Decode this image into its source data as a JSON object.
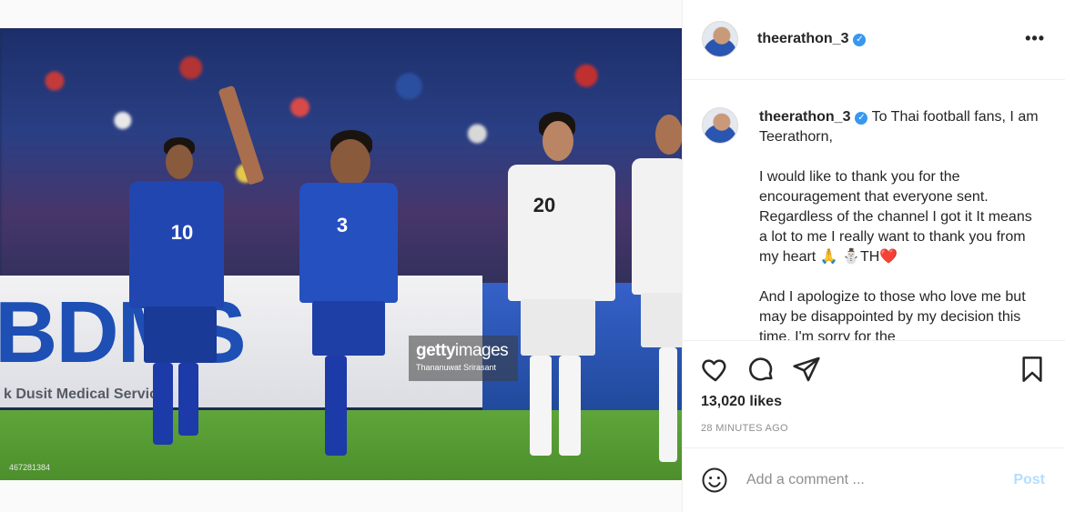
{
  "photo": {
    "banner_text": "BDMS",
    "banner_subtext": "k Dusit Medical Services",
    "watermark": {
      "brand_bold": "getty",
      "brand_light": "images",
      "credit": "Thananuwat Srirasant"
    },
    "image_id": "467281384",
    "players": [
      {
        "number": "10",
        "kit": "blue"
      },
      {
        "number": "3",
        "kit": "blue"
      },
      {
        "number": "20",
        "kit": "white"
      }
    ]
  },
  "header": {
    "username": "theerathon_3",
    "verified_icon": "verified-badge-icon",
    "more_icon": "more-options-icon",
    "more_label": "•••"
  },
  "caption": {
    "username": "theerathon_3",
    "intro": "To Thai football fans, I am Teerathorn,",
    "paragraph_2": "I would like to thank you for the encouragement that everyone sent. Regardless of the channel I got it It means a lot to me I really want to thank you from my heart 🙏 ⛄TH❤️",
    "paragraph_3": "And I apologize to those who love me but may be disappointed by my decision this time. I'm sorry for the"
  },
  "actions": {
    "like_icon": "heart-icon",
    "comment_icon": "comment-icon",
    "share_icon": "share-icon",
    "save_icon": "bookmark-icon",
    "likes": "13,020 likes",
    "time": "28 MINUTES AGO"
  },
  "comment": {
    "emoji_icon": "emoji-icon",
    "placeholder": "Add a comment ...",
    "post_label": "Post"
  },
  "colors": {
    "accent_blue": "#3897f0",
    "post_disabled": "#b2dffc",
    "muted_text": "#8e8e8e"
  }
}
